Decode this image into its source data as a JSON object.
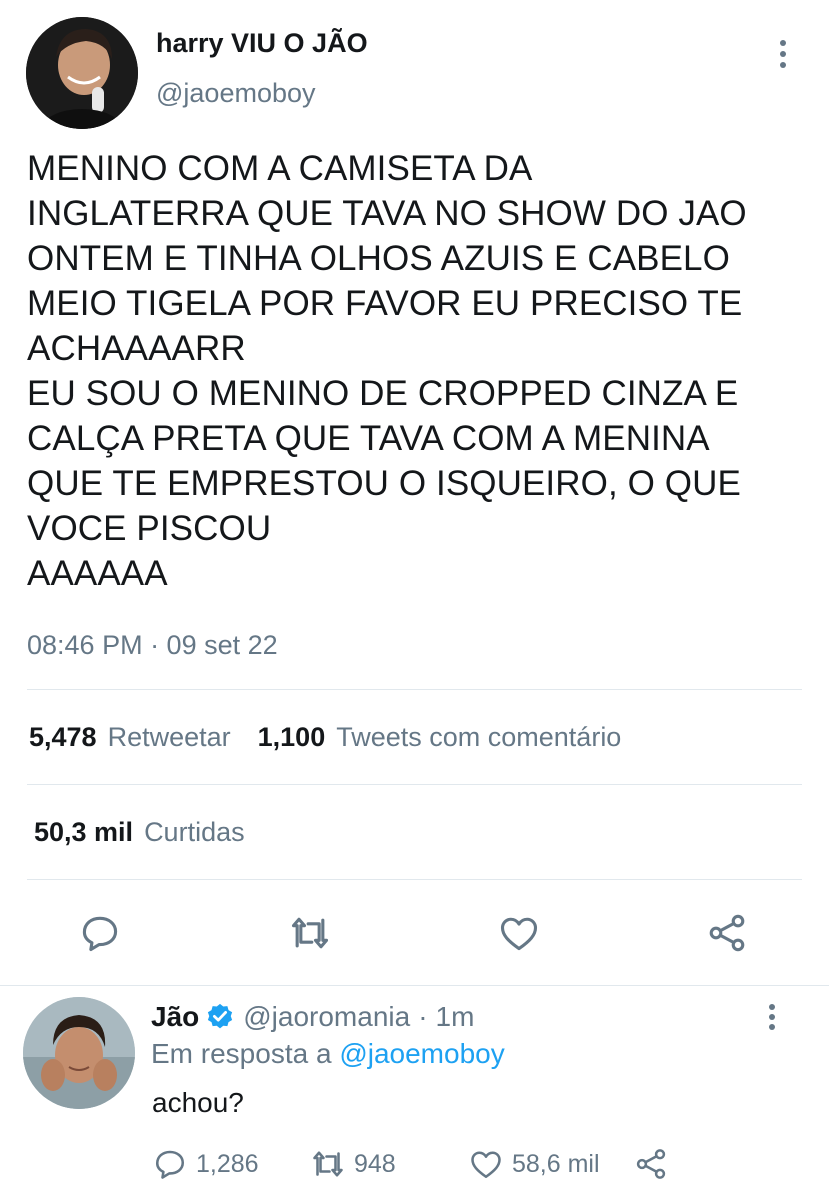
{
  "tweet": {
    "display_name": "harry VIU O JÃO",
    "handle": "@jaoemoboy",
    "text": "MENINO COM A CAMISETA DA\nINGLATERRA QUE TAVA NO SHOW DO JAO\nONTEM E TINHA OLHOS AZUIS E CABELO\nMEIO TIGELA POR FAVOR EU PRECISO TE\nACHAAAARR\nEU SOU O MENINO DE CROPPED CINZA E\nCALÇA PRETA QUE TAVA COM A MENINA\nQUE TE EMPRESTOU O ISQUEIRO, O QUE\nVOCE PISCOU\nAAAAAA",
    "timestamp": "08:46 PM · 09 set 22",
    "stats": {
      "retweets_count": "5,478",
      "retweets_label": "Retweetar",
      "quotes_count": "1,100",
      "quotes_label": "Tweets com comentário",
      "likes_count": "50,3 mil",
      "likes_label": "Curtidas"
    },
    "actions": [
      "reply-icon",
      "retweet-icon",
      "like-icon",
      "share-icon"
    ]
  },
  "reply": {
    "display_name": "Jão",
    "verified": true,
    "handle": "@jaoromania",
    "separator": "·",
    "time": "1m",
    "reply_to_prefix": "Em resposta a",
    "reply_to_handle": "@jaoemoboy",
    "text": "achou?",
    "reply_count": "1,286",
    "retweet_count": "948",
    "like_count": "58,6 mil"
  },
  "colors": {
    "text_primary": "#14171a",
    "text_secondary": "#657786",
    "accent": "#1da1f2",
    "divider": "#e1e8ed",
    "icon": "#657786"
  }
}
